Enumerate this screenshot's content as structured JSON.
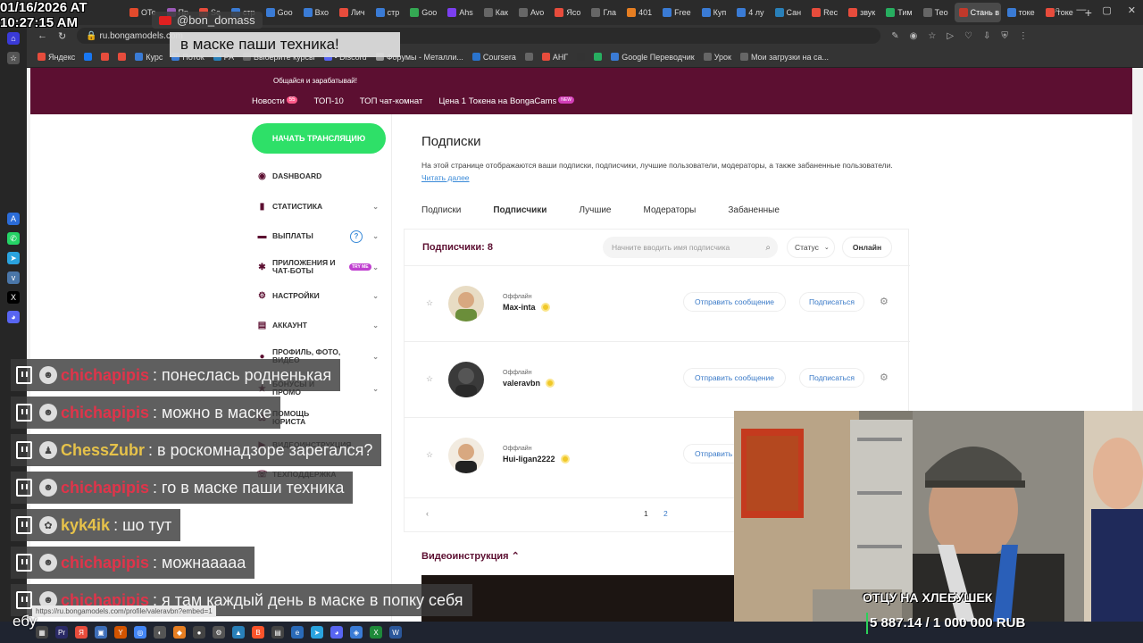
{
  "overlay": {
    "clock_date": "01/16/2026 AT",
    "clock_time": "10:27:15 AM",
    "yt_user": "@bon_domass",
    "yt_message": "в маске паши техника!",
    "status_url": "https://ru.bongamodels.com/profile/valeravbn?embed=1",
    "corner_text": "ебу",
    "goal_title": "ОТЦУ НА ХЛЕБУШЕК",
    "goal_progress_text": "5 887.14 / 1 000 000 RUB",
    "goal_progress_fraction": 0.0059
  },
  "browser": {
    "tabs": [
      {
        "label": "OTe",
        "color": "#e24a2c"
      },
      {
        "label": "Пр",
        "color": "#9b59b6"
      },
      {
        "label": "Se",
        "color": "#e74c3c"
      },
      {
        "label": "стр",
        "color": "#3a7bd5"
      },
      {
        "label": "Goo",
        "color": "#3a7bd5"
      },
      {
        "label": "Вхо",
        "color": "#3a7bd5"
      },
      {
        "label": "Лич",
        "color": "#e74c3c"
      },
      {
        "label": "стр",
        "color": "#3a7bd5"
      },
      {
        "label": "Goo",
        "color": "#34a853"
      },
      {
        "label": "Ahs",
        "color": "#7b3ff0"
      },
      {
        "label": "Как",
        "color": "#666"
      },
      {
        "label": "Avo",
        "color": "#666"
      },
      {
        "label": "Ясо",
        "color": "#e74c3c"
      },
      {
        "label": "Гла",
        "color": "#666"
      },
      {
        "label": "401",
        "color": "#e67e22"
      },
      {
        "label": "Free",
        "color": "#3a7bd5"
      },
      {
        "label": "Куп",
        "color": "#3a7bd5"
      },
      {
        "label": "4 лу",
        "color": "#3a7bd5"
      },
      {
        "label": "Сан",
        "color": "#2980b9"
      },
      {
        "label": "Rec",
        "color": "#e74c3c"
      },
      {
        "label": "звук",
        "color": "#e74c3c"
      },
      {
        "label": "Тим",
        "color": "#27ae60"
      },
      {
        "label": "Тео",
        "color": "#666"
      },
      {
        "label": "Стань в",
        "color": "#c0392b",
        "active": true
      },
      {
        "label": "токе",
        "color": "#3a7bd5"
      },
      {
        "label": "токе",
        "color": "#e74c3c"
      }
    ],
    "url": "ru.bongamodels.com",
    "bookmarks": [
      {
        "label": "Яндекс",
        "color": "#e74c3c"
      },
      {
        "label": "",
        "color": "#1877f2"
      },
      {
        "label": "",
        "color": "#e74c3c"
      },
      {
        "label": "",
        "color": "#e74c3c"
      },
      {
        "label": "Курс",
        "color": "#3a7bd5"
      },
      {
        "label": "Поток",
        "color": "#3a7bd5"
      },
      {
        "label": "PA",
        "color": "#2980b9"
      },
      {
        "label": "Выберите курсы",
        "color": "#666"
      },
      {
        "label": "• Discord",
        "color": "#5865f2"
      },
      {
        "label": "Форумы - Металли...",
        "color": "#999"
      },
      {
        "label": "Coursera",
        "color": "#2a73cc"
      },
      {
        "label": "",
        "color": "#666"
      },
      {
        "label": "АНГ",
        "color": "#e74c3c"
      },
      {
        "label": "",
        "color": "#333"
      },
      {
        "label": "",
        "color": "#27ae60"
      },
      {
        "label": "Google Переводчик",
        "color": "#3a7bd5"
      },
      {
        "label": "Урок",
        "color": "#666"
      },
      {
        "label": "Мои загрузки на са...",
        "color": "#666"
      }
    ]
  },
  "site": {
    "tagline": "Общайся и зарабатывай!",
    "nav": [
      {
        "label": "Новости",
        "badge": "55"
      },
      {
        "label": "ТОП-10"
      },
      {
        "label": "ТОП чат-комнат"
      },
      {
        "label": "Цена 1 Токена на BongaCams",
        "badge_new": "NEW"
      }
    ],
    "cta": "НАЧАТЬ ТРАНСЛЯЦИЮ",
    "sidebar": [
      {
        "label": "DASHBOARD",
        "icon": "◉"
      },
      {
        "label": "СТАТИСТИКА",
        "icon": "▮"
      },
      {
        "label": "ВЫПЛАТЫ",
        "icon": "▬"
      },
      {
        "label": "ПРИЛОЖЕНИЯ И ЧАТ-БОТЫ",
        "icon": "✱",
        "badge": "TRY ME"
      },
      {
        "label": "НАСТРОЙКИ",
        "icon": "⚙"
      },
      {
        "label": "АККАУНТ",
        "icon": "▤"
      },
      {
        "label": "ПРОФИЛЬ, ФОТО, ВИДЕО",
        "icon": "●"
      },
      {
        "label": "БОНУСЫ И ПРОМО",
        "icon": "★"
      },
      {
        "label": "ПОМОЩЬ ЮРИСТА",
        "icon": "⚖"
      },
      {
        "label": "ВИДЕОИНСТРУКЦИЯ",
        "icon": "▶"
      },
      {
        "label": "ТЕХПОДДЕРЖКА",
        "icon": "☏"
      }
    ],
    "help_icon": "?",
    "title": "Подписки",
    "description": "На этой странице отображаются ваши подписки, подписчики, лучшие пользователи, модераторы, а также забаненные пользователи.",
    "read_more": "Читать далее",
    "tabs": [
      "Подписки",
      "Подписчики",
      "Лучшие",
      "Модераторы",
      "Забаненные"
    ],
    "subs_count": "Подписчики: 8",
    "search_placeholder": "Начните вводить имя подписчика",
    "status_label": "Статус",
    "online_label": "Онлайн",
    "subscribers": [
      {
        "status": "Оффлайн",
        "name": "Max-inta",
        "msg": "Отправить сообщение",
        "follow": "Подписаться"
      },
      {
        "status": "Оффлайн",
        "name": "valeravbn",
        "msg": "Отправить сообщение",
        "follow": "Подписаться"
      },
      {
        "status": "Оффлайн",
        "name": "Hui-ligan2222",
        "msg": "Отправить",
        "follow": ""
      }
    ],
    "pages": [
      "1",
      "2"
    ],
    "video_heading": "Видеоинструкция"
  },
  "chat": [
    {
      "nick": "chichapipis",
      "text": ": понеслась родненькая",
      "nick_color": "#e0344a",
      "badge": "☻"
    },
    {
      "nick": "chichapipis",
      "text": ": можно в маске",
      "nick_color": "#e0344a",
      "badge": "☻"
    },
    {
      "nick": "ChessZubr",
      "text": ": в роскомнадзоре зарегался?",
      "nick_color": "#e6c24a",
      "badge": "♟"
    },
    {
      "nick": "chichapipis",
      "text": ": го в маске паши техника",
      "nick_color": "#e0344a",
      "badge": "☻"
    },
    {
      "nick": "kyk4ik",
      "text": ": шо тут",
      "nick_color": "#e6c24a",
      "badge": "✿"
    },
    {
      "nick": "chichapipis",
      "text": ": можнааааа",
      "nick_color": "#e0344a",
      "badge": "☻"
    },
    {
      "nick": "chichapipis",
      "text": ": я там каждый день в маске в попку себя",
      "nick_color": "#e0344a",
      "badge": "☻"
    }
  ]
}
